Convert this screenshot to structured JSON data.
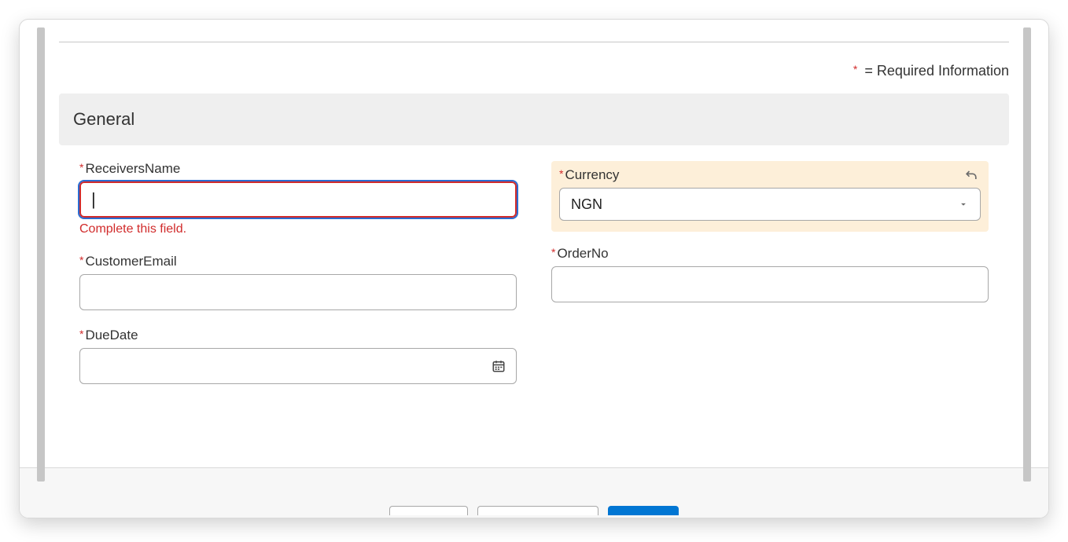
{
  "legend": {
    "asterisk": "*",
    "text": "= Required Information"
  },
  "section": {
    "title": "General"
  },
  "fields": {
    "receiversName": {
      "label": "ReceiversName",
      "asterisk": "*",
      "value": "",
      "error": "Complete this field."
    },
    "customerEmail": {
      "label": "CustomerEmail",
      "asterisk": "*",
      "value": ""
    },
    "dueDate": {
      "label": "DueDate",
      "asterisk": "*",
      "value": ""
    },
    "currency": {
      "label": "Currency",
      "asterisk": "*",
      "selected": "NGN"
    },
    "orderNo": {
      "label": "OrderNo",
      "asterisk": "*",
      "value": ""
    }
  }
}
